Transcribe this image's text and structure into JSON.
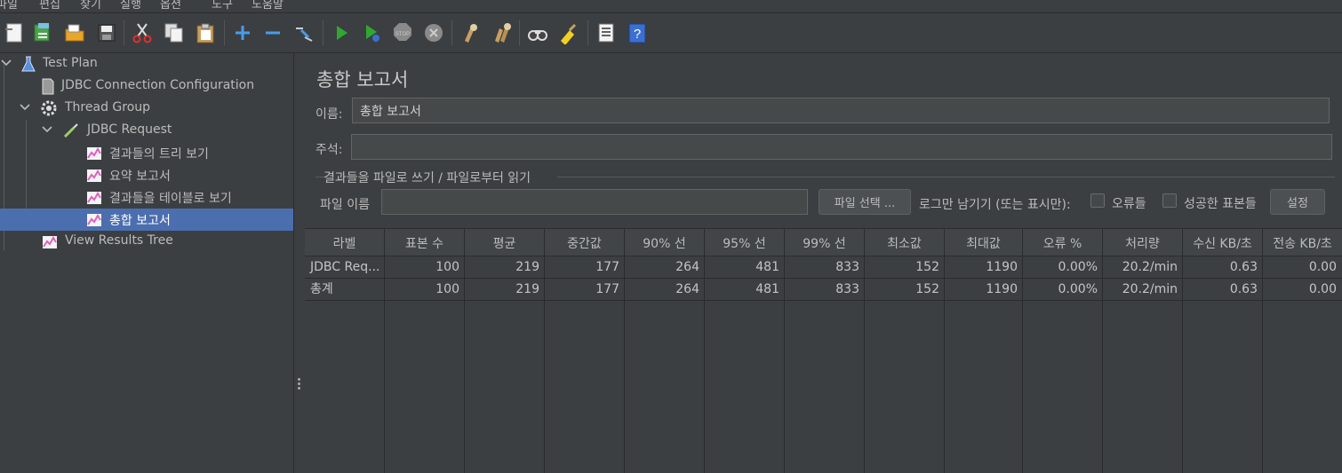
{
  "menu": [
    "파일",
    "편집",
    "찾기",
    "실행",
    "옵션",
    "도구",
    "도움말"
  ],
  "toolbar_icons": [
    "new-icon",
    "templates-icon",
    "open-icon",
    "save-icon",
    "cut-icon",
    "copy-icon",
    "paste-icon",
    "expand-icon",
    "collapse-icon",
    "toggle-icon",
    "start-icon",
    "start-no-pause-icon",
    "stop-icon",
    "shutdown-icon",
    "clear-icon",
    "clear-all-icon",
    "search-icon",
    "reset-search-icon",
    "function-helper-icon",
    "help-icon"
  ],
  "tree": {
    "items": [
      {
        "label": "Test Plan"
      },
      {
        "label": "JDBC Connection Configuration"
      },
      {
        "label": "Thread Group"
      },
      {
        "label": "JDBC Request"
      },
      {
        "label": "결과들의 트리 보기"
      },
      {
        "label": "요약 보고서"
      },
      {
        "label": "결과들을 테이블로 보기"
      },
      {
        "label": "총합 보고서"
      },
      {
        "label": "View Results Tree"
      }
    ]
  },
  "panel": {
    "title": "총합 보고서",
    "name_label": "이름:",
    "name_value": "총합 보고서",
    "comment_label": "주석:",
    "comment_value": "",
    "file_section_title": "결과들을 파일로 쓰기 / 파일로부터 읽기",
    "filename_label": "파일 이름",
    "filename_value": "",
    "browse_button": "파일 선택 ...",
    "log_only_label": "로그만 남기기 (또는 표시만):",
    "errors_label": "오류들",
    "success_label": "성공한 표본들",
    "configure_button": "설정"
  },
  "table": {
    "columns": [
      "라벨",
      "표본 수",
      "평균",
      "중간값",
      "90% 선",
      "95% 선",
      "99% 선",
      "최소값",
      "최대값",
      "오류 %",
      "처리량",
      "수신 KB/초",
      "전송 KB/초"
    ],
    "rows": [
      [
        "JDBC Req...",
        "100",
        "219",
        "177",
        "264",
        "481",
        "833",
        "152",
        "1190",
        "0.00%",
        "20.2/min",
        "0.63",
        "0.00"
      ],
      [
        "총계",
        "100",
        "219",
        "177",
        "264",
        "481",
        "833",
        "152",
        "1190",
        "0.00%",
        "20.2/min",
        "0.63",
        "0.00"
      ]
    ]
  },
  "colors": {
    "background": "#3c3f41",
    "selection": "#4b6eaf",
    "text": "#bbbbbb"
  }
}
